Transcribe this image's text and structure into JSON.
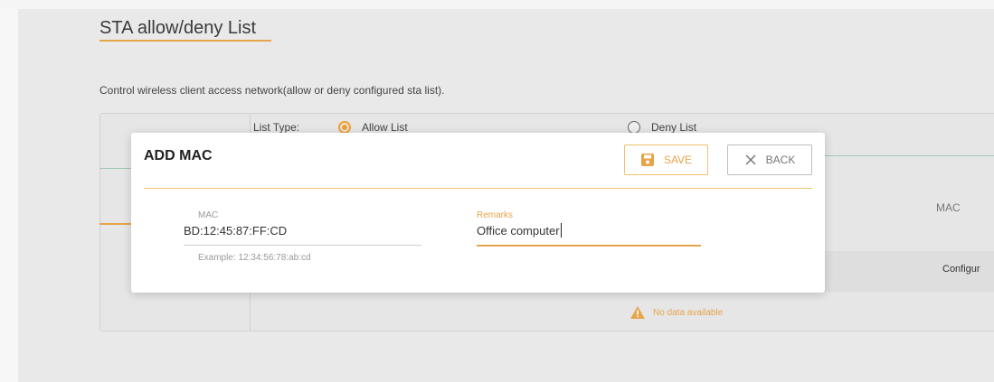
{
  "page": {
    "title": "STA allow/deny List",
    "description": "Control wireless client access network(allow or deny configured sta list)."
  },
  "list_type": {
    "label": "List Type:",
    "options": [
      {
        "label": "Allow List",
        "selected": true
      },
      {
        "label": "Deny List",
        "selected": false
      }
    ]
  },
  "table": {
    "columns": [
      "MAC",
      "Configur"
    ],
    "empty_text": "No data available"
  },
  "modal": {
    "title": "ADD MAC",
    "save_label": "SAVE",
    "back_label": "BACK",
    "mac": {
      "label": "MAC",
      "value": "BD:12:45:87:FF:CD",
      "hint": "Example: 12:34:56:78:ab:cd"
    },
    "remarks": {
      "label": "Remarks",
      "value": "Office computer"
    }
  },
  "icons": {
    "save": "save-icon",
    "back": "close-icon",
    "warning": "warning-icon"
  },
  "colors": {
    "accent": "#e8a44a",
    "text": "#333333",
    "muted": "#999999",
    "divider": "#9fc7b0"
  }
}
